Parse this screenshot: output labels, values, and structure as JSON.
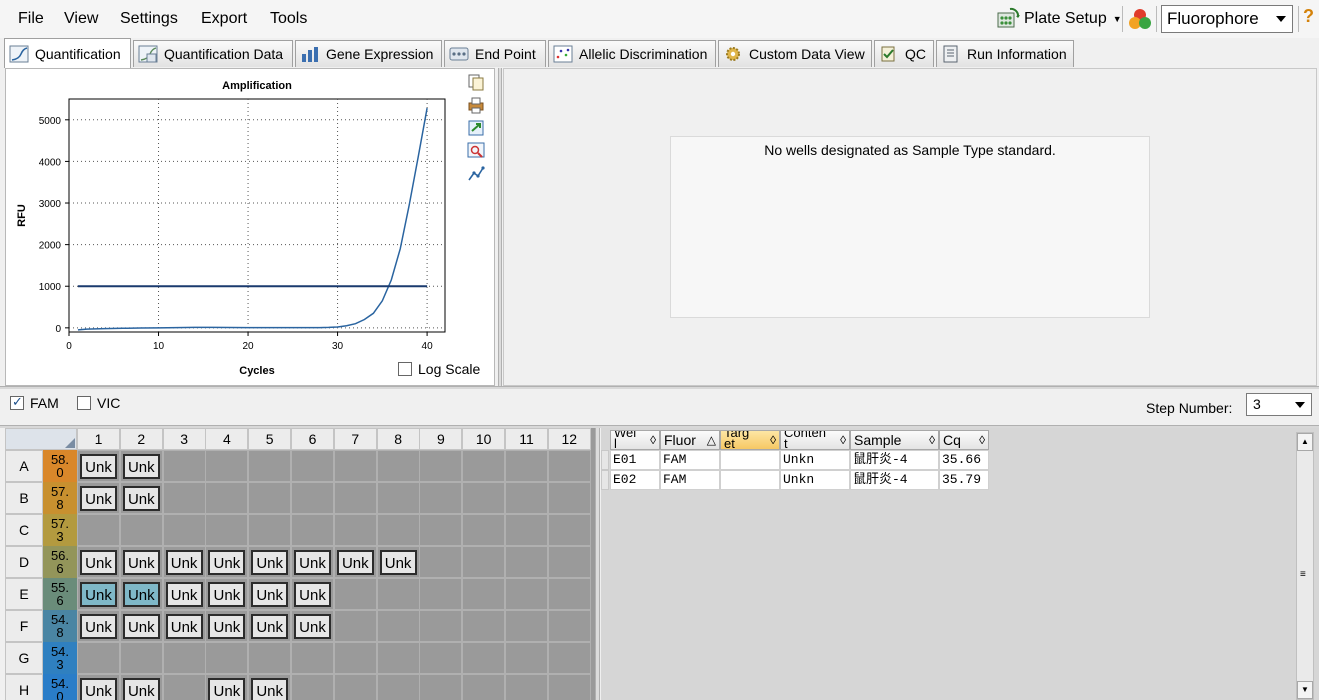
{
  "menu": [
    "File",
    "View",
    "Settings",
    "Export",
    "Tools"
  ],
  "toolbar": {
    "plate_setup": "Plate Setup",
    "view_select": "Fluorophore",
    "help": "?"
  },
  "tabs": [
    {
      "label": "Quantification",
      "icon": "amplification-icon"
    },
    {
      "label": "Quantification Data",
      "icon": "quant-data-icon"
    },
    {
      "label": "Gene Expression",
      "icon": "bar-chart-icon"
    },
    {
      "label": "End Point",
      "icon": "end-point-icon"
    },
    {
      "label": "Allelic Discrimination",
      "icon": "scatter-icon"
    },
    {
      "label": "Custom Data View",
      "icon": "gear-icon"
    },
    {
      "label": "QC",
      "icon": "qc-icon"
    },
    {
      "label": "Run Information",
      "icon": "run-info-icon"
    }
  ],
  "chart_data": {
    "type": "line",
    "title": "Amplification",
    "xlabel": "Cycles",
    "ylabel": "RFU",
    "xlim": [
      0,
      42
    ],
    "ylim": [
      -100,
      5500
    ],
    "xticks": [
      0,
      10,
      20,
      30,
      40
    ],
    "yticks": [
      0,
      1000,
      2000,
      3000,
      4000,
      5000
    ],
    "grid": true,
    "series": [
      {
        "x": [
          1,
          2,
          4,
          6,
          8,
          10,
          12,
          14,
          16,
          18,
          20,
          22,
          24,
          26,
          28,
          29,
          30,
          31,
          32,
          33,
          34,
          35,
          36,
          37,
          38,
          39,
          40
        ],
        "y": [
          -50,
          -30,
          -20,
          -10,
          -5,
          0,
          5,
          10,
          10,
          8,
          5,
          5,
          5,
          5,
          5,
          10,
          20,
          50,
          100,
          200,
          350,
          650,
          1150,
          1900,
          2950,
          4100,
          5280
        ],
        "color": "#2a64a0"
      },
      {
        "x": [
          1,
          40
        ],
        "y": [
          1000,
          1000
        ],
        "color": "#1a3a6e"
      }
    ],
    "log_scale_label": "Log Scale",
    "log_scale": false
  },
  "right_panel": {
    "message": "No wells designated as Sample Type standard."
  },
  "fluorophores": [
    {
      "label": "FAM",
      "checked": true
    },
    {
      "label": "VIC",
      "checked": false
    }
  ],
  "step": {
    "label": "Step Number:",
    "value": "3"
  },
  "plate": {
    "columns": [
      "1",
      "2",
      "3",
      "4",
      "5",
      "6",
      "7",
      "8",
      "9",
      "10",
      "11",
      "12"
    ],
    "rows": [
      {
        "label": "A",
        "temp": "58.\n0",
        "temp_color": "#d9872a",
        "wells": [
          1,
          2
        ]
      },
      {
        "label": "B",
        "temp": "57.\n8",
        "temp_color": "#c8902f",
        "wells": [
          1,
          2
        ]
      },
      {
        "label": "C",
        "temp": "57.\n3",
        "temp_color": "#b39a3f",
        "wells": []
      },
      {
        "label": "D",
        "temp": "56.\n6",
        "temp_color": "#93955a",
        "wells": [
          1,
          2,
          3,
          4,
          5,
          6,
          7,
          8
        ]
      },
      {
        "label": "E",
        "temp": "55.\n6",
        "temp_color": "#6a8c7a",
        "wells": [
          1,
          2,
          3,
          4,
          5,
          6
        ]
      },
      {
        "label": "F",
        "temp": "54.\n8",
        "temp_color": "#4a85a3",
        "wells": [
          1,
          2,
          3,
          4,
          5,
          6
        ]
      },
      {
        "label": "G",
        "temp": "54.\n3",
        "temp_color": "#2f80c0",
        "wells": []
      },
      {
        "label": "H",
        "temp": "54.\n0",
        "temp_color": "#2a7dc8",
        "wells": [
          1,
          2,
          4,
          5
        ]
      }
    ],
    "well_label": "Unk",
    "selected": [
      "E1",
      "E2"
    ]
  },
  "table": {
    "headers": [
      "Wel\nl",
      "Fluor",
      "Targ\net",
      "Conten\nt",
      "Sample",
      "Cq"
    ],
    "sorted_column": "Targ\net",
    "rows": [
      [
        "E01",
        "FAM",
        "",
        "Unkn",
        "鼠肝炎-4",
        "35.66"
      ],
      [
        "E02",
        "FAM",
        "",
        "Unkn",
        "鼠肝炎-4",
        "35.79"
      ]
    ]
  }
}
